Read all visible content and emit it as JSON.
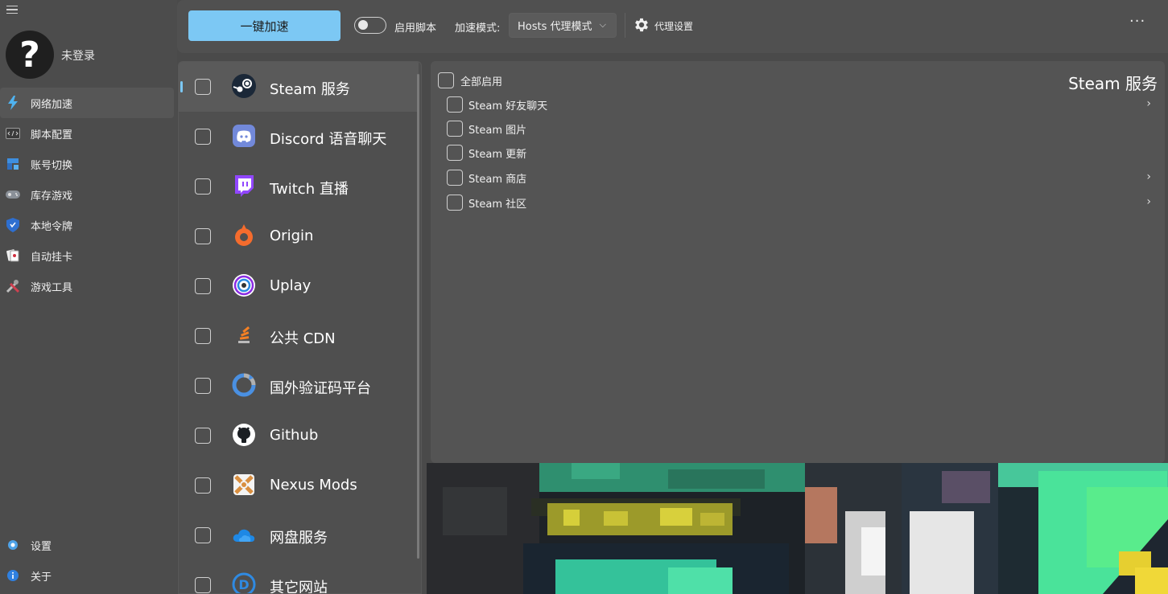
{
  "sidebar": {
    "username": "未登录",
    "items": [
      {
        "label": "网络加速",
        "active": true
      },
      {
        "label": "脚本配置"
      },
      {
        "label": "账号切换"
      },
      {
        "label": "库存游戏"
      },
      {
        "label": "本地令牌"
      },
      {
        "label": "自动挂卡"
      },
      {
        "label": "游戏工具"
      }
    ],
    "bottom": [
      {
        "label": "设置"
      },
      {
        "label": "关于"
      }
    ]
  },
  "toolbar": {
    "accelerate_label": "一键加速",
    "script_toggle_label": "启用脚本",
    "script_toggle_on": false,
    "mode_label": "加速模式:",
    "mode_value": "Hosts 代理模式",
    "proxy_settings_label": "代理设置",
    "more_label": "···"
  },
  "services": [
    {
      "label": "Steam 服务",
      "icon": "steam-icon",
      "active": true
    },
    {
      "label": "Discord 语音聊天",
      "icon": "discord-icon"
    },
    {
      "label": "Twitch 直播",
      "icon": "twitch-icon"
    },
    {
      "label": "Origin",
      "icon": "origin-icon"
    },
    {
      "label": "Uplay",
      "icon": "uplay-icon"
    },
    {
      "label": "公共 CDN",
      "icon": "cdn-icon"
    },
    {
      "label": "国外验证码平台",
      "icon": "captcha-icon"
    },
    {
      "label": "Github",
      "icon": "github-icon"
    },
    {
      "label": "Nexus Mods",
      "icon": "nexus-icon"
    },
    {
      "label": "网盘服务",
      "icon": "cloud-icon"
    },
    {
      "label": "其它网站",
      "icon": "other-icon"
    }
  ],
  "detail": {
    "enable_all_label": "全部启用",
    "title": "Steam 服务",
    "items": [
      {
        "label": "Steam 好友聊天",
        "has_children": true
      },
      {
        "label": "Steam 图片",
        "has_children": false
      },
      {
        "label": "Steam 更新",
        "has_children": false
      },
      {
        "label": "Steam 商店",
        "has_children": true
      },
      {
        "label": "Steam 社区",
        "has_children": true
      }
    ]
  },
  "colors": {
    "accent": "#7cc8f4",
    "background": "#4a4a4a",
    "panel": "#545454"
  }
}
